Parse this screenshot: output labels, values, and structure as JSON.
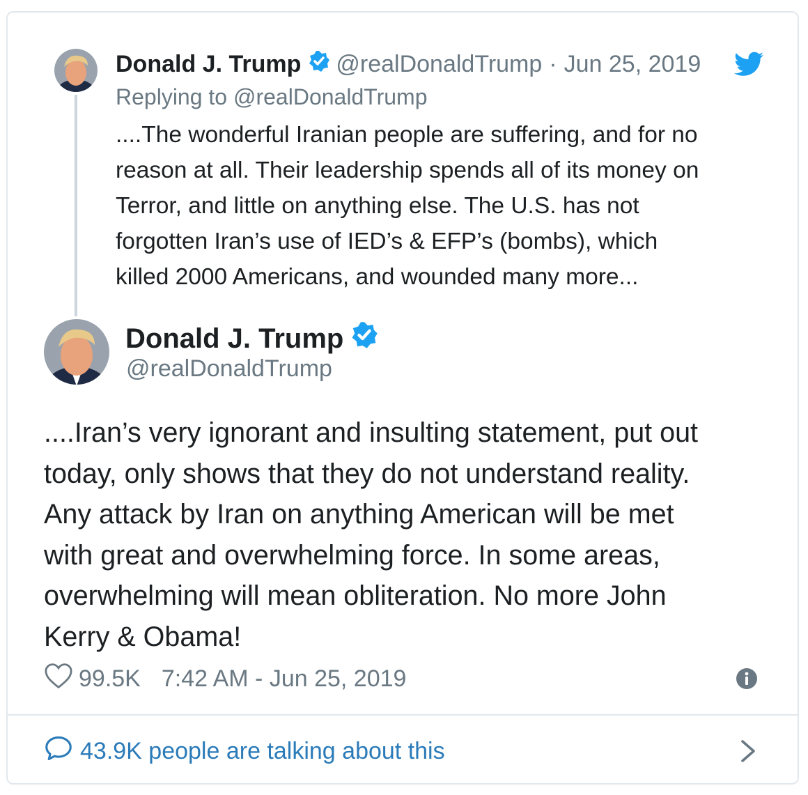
{
  "colors": {
    "verified_blue": "#1da1f2",
    "link_blue": "#2b7bb9",
    "muted_gray": "#697882",
    "text": "#1c2022",
    "border": "#e1e8ed"
  },
  "icons": {
    "verified": "verified-badge-icon",
    "brand": "twitter-bird-icon",
    "like": "heart-icon",
    "info": "info-icon",
    "conversation": "speech-bubble-icon",
    "next": "chevron-right-icon"
  },
  "parent_tweet": {
    "name": "Donald J. Trump",
    "handle": "@realDonaldTrump",
    "separator": "·",
    "date": "Jun 25, 2019",
    "replying_to": "Replying to @realDonaldTrump",
    "text_lines": [
      "....The wonderful Iranian people are suffering, and for no",
      "reason at all. Their leadership spends all of its money on",
      "Terror, and little on anything else. The U.S. has not",
      "forgotten Iran’s use of IED’s & EFP’s (bombs), which",
      "killed 2000 Americans, and wounded many more..."
    ]
  },
  "main_tweet": {
    "name": "Donald J. Trump",
    "handle": "@realDonaldTrump",
    "text_lines": [
      "....Iran’s very ignorant and insulting statement, put out",
      "today, only shows that they do not understand reality.",
      "Any attack by Iran on anything American will be met",
      "with great and overwhelming force. In some areas,",
      "overwhelming will mean obliteration. No more John",
      "Kerry & Obama!"
    ],
    "likes": "99.5K",
    "timestamp": "7:42 AM - Jun 25, 2019"
  },
  "footer": {
    "talking_label": "43.9K people are talking about this"
  }
}
